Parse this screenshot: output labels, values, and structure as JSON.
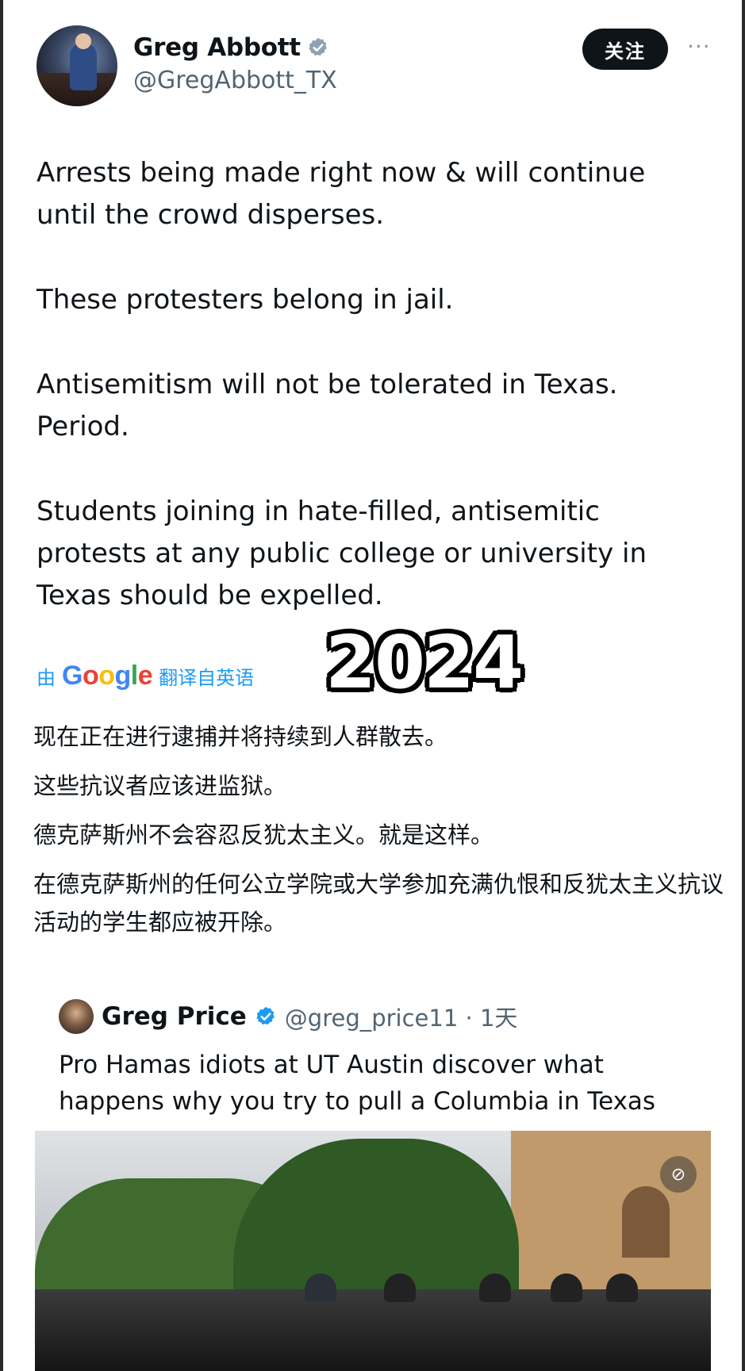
{
  "tweet": {
    "author": {
      "display_name": "Greg Abbott",
      "handle": "@GregAbbott_TX"
    },
    "follow_label": "关注",
    "more_label": "···",
    "paragraphs": [
      "Arrests being made right now & will continue until the crowd disperses.",
      "These protesters belong in jail.",
      "Antisemitism will not be tolerated in Texas. Period.",
      "Students joining in hate-filled, antisemitic protests at any public college or university in Texas should be expelled."
    ],
    "translation": {
      "prefix": "由",
      "provider": "Google",
      "suffix": "翻译自英语",
      "paragraphs": [
        "现在正在进行逮捕并将持续到人群散去。",
        "这些抗议者应该进监狱。",
        "德克萨斯州不会容忍反犹太主义。就是这样。",
        "在德克萨斯州的任何公立学院或大学参加充满仇恨和反犹太主义抗议活动的学生都应被开除。"
      ]
    }
  },
  "overlay": {
    "year": "2024"
  },
  "quoted_tweet": {
    "author": {
      "display_name": "Greg Price",
      "handle_time": "@greg_price11 · 1天"
    },
    "text": "Pro Hamas idiots at UT Austin discover what happens why you try to pull a Columbia in Texas"
  },
  "icons": {
    "verified": "verified-badge-icon",
    "sensitive": "sensitive-media-icon"
  },
  "colors": {
    "verified": "#1d9bf0",
    "link": "#1d9bf0",
    "secondary_text": "#536471",
    "follow_bg": "#0f1419"
  }
}
